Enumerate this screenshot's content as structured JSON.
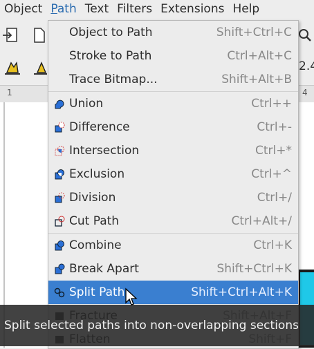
{
  "menubar": {
    "items": [
      {
        "label": "Object",
        "mnemonic_index": 0
      },
      {
        "label": "Path",
        "mnemonic_index": 0
      },
      {
        "label": "Text",
        "mnemonic_index": 0
      },
      {
        "label": "Filters",
        "mnemonic_index": 1
      },
      {
        "label": "Extensions",
        "mnemonic_index": 1
      },
      {
        "label": "Help",
        "mnemonic_index": 0
      }
    ]
  },
  "toolbar": {
    "partial_value": "2.4"
  },
  "ruler": {
    "left_tick": "1",
    "right_tick": "4"
  },
  "path_menu": {
    "items": [
      {
        "label": "Object to Path",
        "shortcut": "Shift+Ctrl+C",
        "icon": "none"
      },
      {
        "label": "Stroke to Path",
        "shortcut": "Ctrl+Alt+C",
        "icon": "none"
      },
      {
        "label": "Trace Bitmap...",
        "shortcut": "Shift+Alt+B",
        "icon": "none"
      },
      {
        "label": "Union",
        "shortcut": "Ctrl++",
        "icon": "union-icon"
      },
      {
        "label": "Difference",
        "shortcut": "Ctrl+-",
        "icon": "difference-icon"
      },
      {
        "label": "Intersection",
        "shortcut": "Ctrl+*",
        "icon": "intersection-icon"
      },
      {
        "label": "Exclusion",
        "shortcut": "Ctrl+^",
        "icon": "exclusion-icon"
      },
      {
        "label": "Division",
        "shortcut": "Ctrl+/",
        "icon": "division-icon"
      },
      {
        "label": "Cut Path",
        "shortcut": "Ctrl+Alt+/",
        "icon": "cut-path-icon"
      },
      {
        "label": "Combine",
        "shortcut": "Ctrl+K",
        "icon": "combine-icon"
      },
      {
        "label": "Break Apart",
        "shortcut": "Shift+Ctrl+K",
        "icon": "break-apart-icon"
      },
      {
        "label": "Split Path",
        "shortcut": "Shift+Ctrl+Alt+K",
        "icon": "split-path-icon"
      },
      {
        "label": "Fracture",
        "shortcut": "Shift+Alt+F",
        "icon": "fracture-icon"
      },
      {
        "label": "Flatten",
        "shortcut": "Shift+F",
        "icon": "flatten-icon"
      }
    ],
    "highlighted_label": "Split Path"
  },
  "tooltip": {
    "text": "Split selected paths into non-overlapping sections"
  },
  "colors": {
    "highlight": "#3a7fd0",
    "menu_background": "#ececec",
    "icon_blue": "#2a6fd6",
    "icon_red": "#d03030",
    "canvas_object": "#1fc8e8"
  }
}
